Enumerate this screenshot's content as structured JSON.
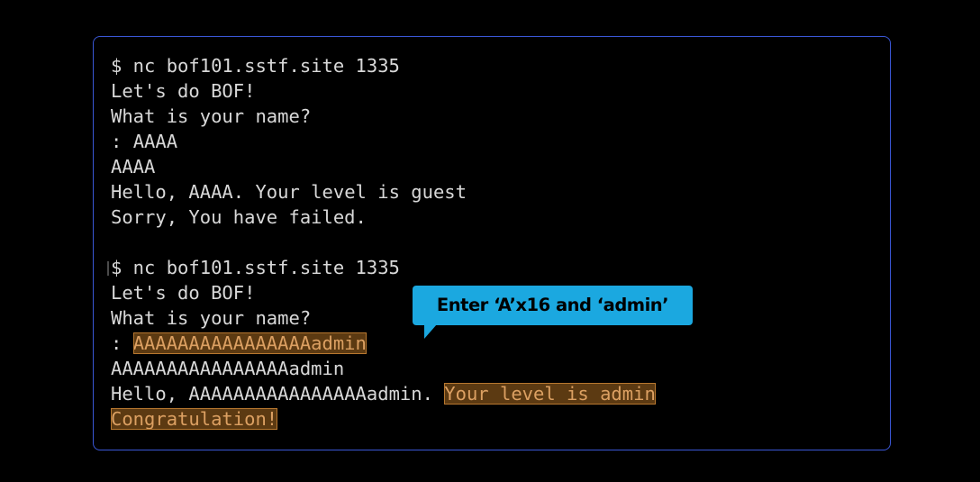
{
  "terminal": {
    "session1": {
      "command": "$ nc bof101.sstf.site 1335",
      "greeting": "Let's do BOF!",
      "question": "What is your name?",
      "prompt": ": ",
      "input": "AAAA",
      "echo": "AAAA",
      "hello_prefix": "Hello, ",
      "hello_name": "AAAA",
      "level_text": ". Your level is guest",
      "result": "Sorry, You have failed."
    },
    "session2": {
      "command": "$ nc bof101.sstf.site 1335",
      "greeting": "Let's do BOF!",
      "question": "What is your name?",
      "prompt": ": ",
      "input": "AAAAAAAAAAAAAAAAadmin",
      "echo": "AAAAAAAAAAAAAAAAadmin",
      "hello_prefix": "Hello, ",
      "hello_name": "AAAAAAAAAAAAAAAAadmin.",
      "level_text": "Your level is admin",
      "result": "Congratulation!"
    }
  },
  "callout": {
    "text": "Enter ‘A’x16 and ‘admin’"
  },
  "colors": {
    "background": "#000000",
    "border": "#3a57d6",
    "text": "#d8d8d8",
    "highlight_bg": "#5c3a12",
    "highlight_text": "#dca062",
    "callout_bg": "#1ba8e0"
  }
}
